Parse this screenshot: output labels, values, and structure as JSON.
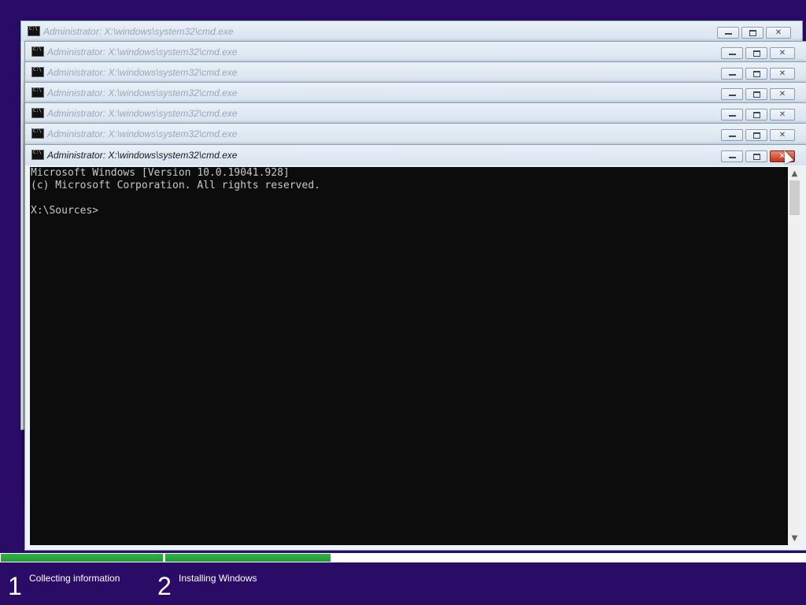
{
  "background_color": "#2a0c66",
  "windows": [
    {
      "title": "Administrator: X:\\windows\\system32\\cmd.exe"
    },
    {
      "title": "Administrator: X:\\windows\\system32\\cmd.exe"
    },
    {
      "title": "Administrator: X:\\windows\\system32\\cmd.exe"
    },
    {
      "title": "Administrator: X:\\windows\\system32\\cmd.exe"
    },
    {
      "title": "Administrator: X:\\windows\\system32\\cmd.exe"
    },
    {
      "title": "Administrator: X:\\windows\\system32\\cmd.exe"
    }
  ],
  "active_window": {
    "title": "Administrator: X:\\windows\\system32\\cmd.exe",
    "console_text": "Microsoft Windows [Version 10.0.19041.928]\n(c) Microsoft Corporation. All rights reserved.\n\nX:\\Sources>"
  },
  "icons": {
    "app": "cmd-console-icon",
    "minimize": "minimize-icon",
    "maximize": "maximize-icon",
    "close": "close-icon"
  },
  "setup": {
    "progress_color": "#27a83d",
    "steps": [
      {
        "number": "1",
        "label": "Collecting information"
      },
      {
        "number": "2",
        "label": "Installing Windows"
      }
    ]
  }
}
